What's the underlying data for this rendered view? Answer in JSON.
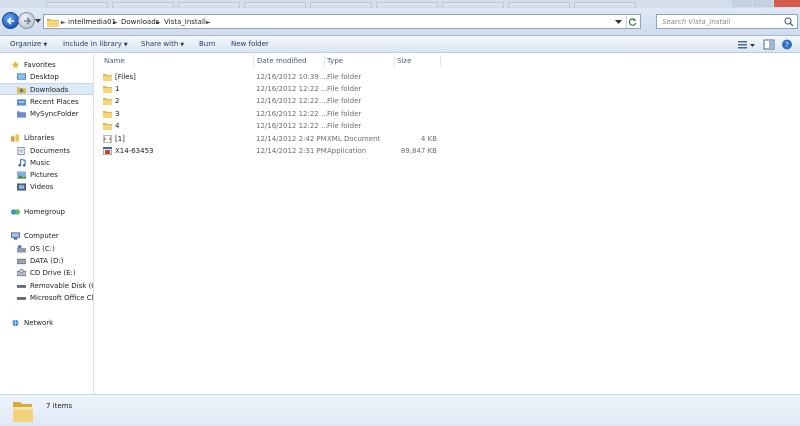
{
  "address": {
    "crumbs": [
      "intellmedia01",
      "Downloads",
      "Vista_Install"
    ]
  },
  "search": {
    "placeholder": "Search Vista_Install"
  },
  "toolbar": {
    "organize": "Organize",
    "include_in_library": "Include in library",
    "share_with": "Share with",
    "burn": "Burn",
    "new_folder": "New folder"
  },
  "nav": {
    "favorites": "Favorites",
    "desktop": "Desktop",
    "downloads": "Downloads",
    "recent_places": "Recent Places",
    "mysyncfolder": "MySyncFolder",
    "libraries": "Libraries",
    "documents": "Documents",
    "music": "Music",
    "pictures": "Pictures",
    "videos": "Videos",
    "homegroup": "Homegroup",
    "computer": "Computer",
    "os_c": "OS (C:)",
    "data_d": "DATA (D:)",
    "cd_drive_e": "CD Drive (E:)",
    "removable_g": "Removable Disk (G:)",
    "ms_office": "Microsoft Office Clic",
    "network": "Network"
  },
  "columns": {
    "name": "Name",
    "date_modified": "Date modified",
    "type": "Type",
    "size": "Size"
  },
  "files": [
    {
      "name": "[Files]",
      "date": "12/16/2012 10:39 ...",
      "type": "File folder",
      "size": "",
      "icon": "folder-icon"
    },
    {
      "name": "1",
      "date": "12/16/2012 12:22 ...",
      "type": "File folder",
      "size": "",
      "icon": "folder-icon"
    },
    {
      "name": "2",
      "date": "12/16/2012 12:22 ...",
      "type": "File folder",
      "size": "",
      "icon": "folder-icon"
    },
    {
      "name": "3",
      "date": "12/16/2012 12:22 ...",
      "type": "File folder",
      "size": "",
      "icon": "folder-icon"
    },
    {
      "name": "4",
      "date": "12/16/2012 12:22 ...",
      "type": "File folder",
      "size": "",
      "icon": "folder-icon"
    },
    {
      "name": "[1]",
      "date": "12/14/2012 2:42 PM",
      "type": "XML Document",
      "size": "4 KB",
      "icon": "xml-document-icon"
    },
    {
      "name": "X14-63453",
      "date": "12/14/2012 2:31 PM",
      "type": "Application",
      "size": "89,847 KB",
      "icon": "application-icon"
    }
  ],
  "status": {
    "item_count": "7 items"
  },
  "colors": {
    "accent": "#1f5fbf",
    "selection": "#dde9f8",
    "chrome": "#dfe9f5"
  }
}
